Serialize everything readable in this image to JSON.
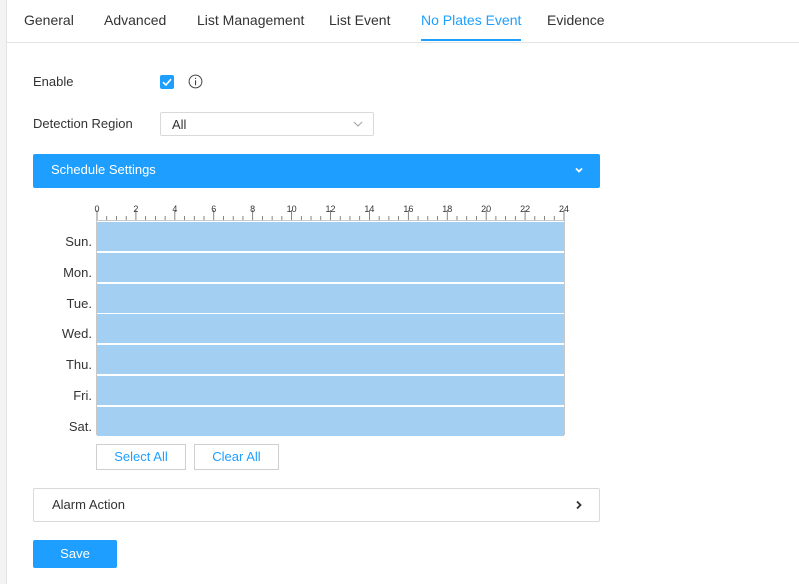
{
  "tabs": [
    {
      "label": "General",
      "active": false
    },
    {
      "label": "Advanced",
      "active": false
    },
    {
      "label": "List Management",
      "active": false
    },
    {
      "label": "List Event",
      "active": false
    },
    {
      "label": "No Plates Event",
      "active": true
    },
    {
      "label": "Evidence",
      "active": false
    }
  ],
  "form": {
    "enable_label": "Enable",
    "enable_checked": true,
    "detection_region_label": "Detection Region",
    "detection_region_value": "All"
  },
  "schedule": {
    "title": "Schedule Settings",
    "hour_labels": [
      "0",
      "2",
      "4",
      "6",
      "8",
      "10",
      "12",
      "14",
      "16",
      "18",
      "20",
      "22",
      "24"
    ],
    "days": [
      "Sun.",
      "Mon.",
      "Tue.",
      "Wed.",
      "Thu.",
      "Fri.",
      "Sat."
    ],
    "select_all_label": "Select All",
    "clear_all_label": "Clear All"
  },
  "alarm": {
    "title": "Alarm Action"
  },
  "save_label": "Save",
  "colors": {
    "accent": "#1e9fff",
    "schedule_fill": "#a3cff2"
  }
}
